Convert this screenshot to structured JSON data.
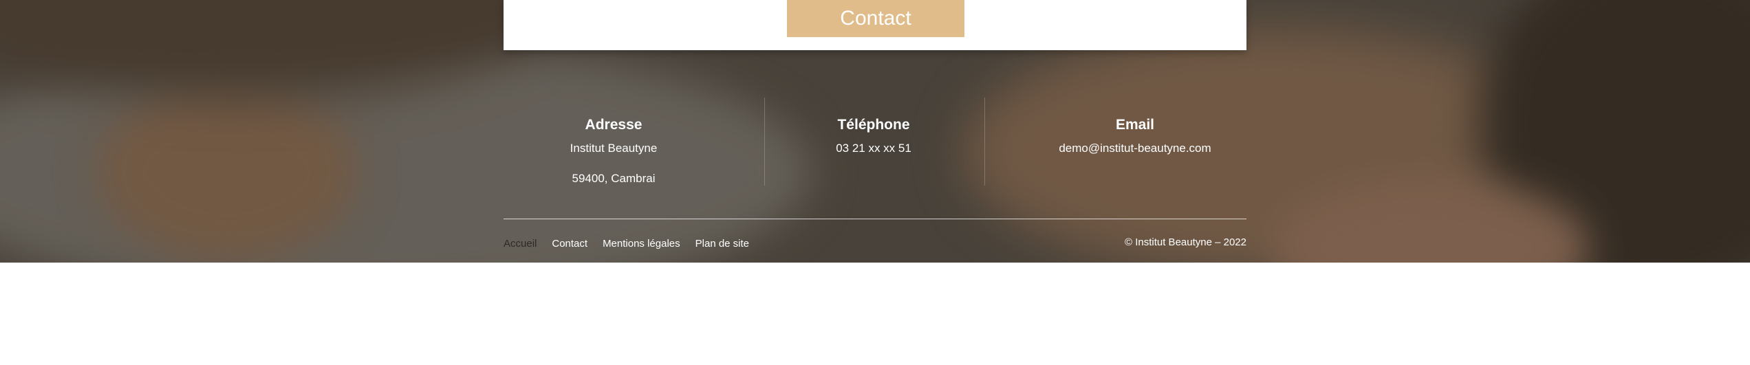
{
  "contact_button": "Contact",
  "info": {
    "address": {
      "title": "Adresse",
      "line1": "Institut Beautyne",
      "line2": "59400, Cambrai"
    },
    "phone": {
      "title": "Téléphone",
      "value": "03 21 xx xx 51"
    },
    "email": {
      "title": "Email",
      "value": "demo@institut-beautyne.com"
    }
  },
  "footer_nav": [
    "Accueil",
    "Contact",
    "Mentions légales",
    "Plan de site"
  ],
  "copyright": "© Institut Beautyne – 2022",
  "colors": {
    "accent": "#e0bc8a",
    "footer_text": "#ffffff",
    "nav_current": "#2f2a24"
  }
}
